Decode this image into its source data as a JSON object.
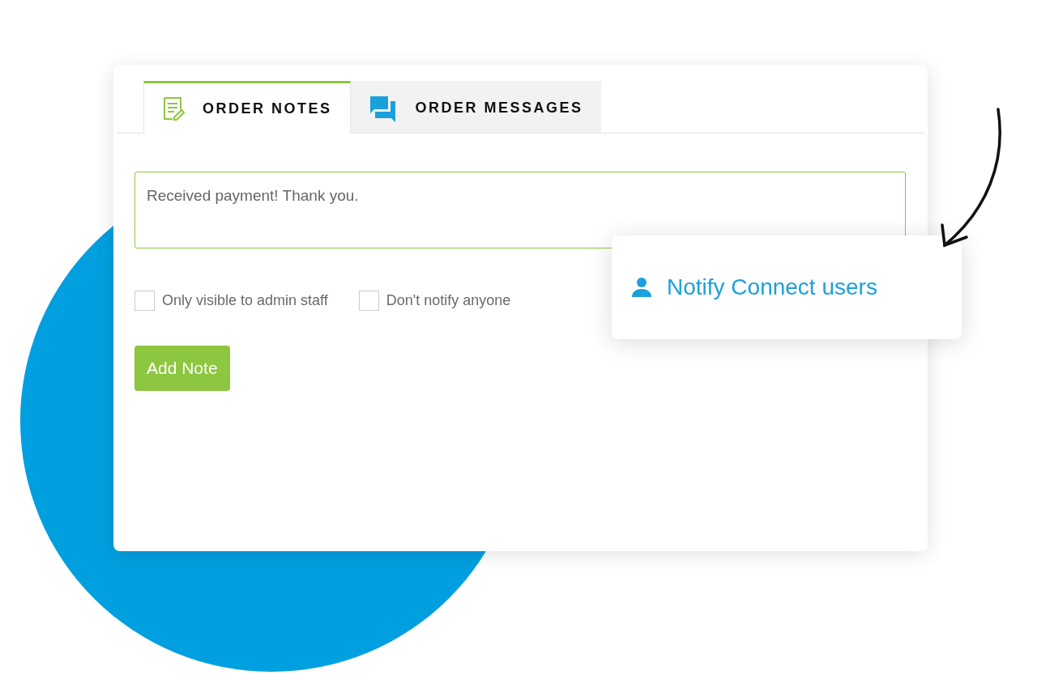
{
  "tabs": [
    {
      "label": "ORDER NOTES",
      "selected": true,
      "kind": "notes"
    },
    {
      "label": "ORDER MESSAGES",
      "selected": false,
      "kind": "messages"
    }
  ],
  "note_field": {
    "value": "Received payment! Thank you."
  },
  "options": [
    {
      "label": "Only visible to admin staff",
      "checked": false
    },
    {
      "label": "Don't notify anyone",
      "checked": false
    }
  ],
  "add_button": "Add Note",
  "callout": {
    "label": "Notify Connect users"
  }
}
